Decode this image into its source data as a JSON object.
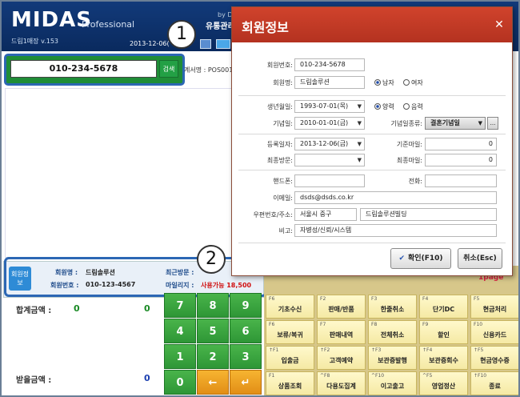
{
  "header": {
    "logo": "MIDAS",
    "logo_sub": "Professional",
    "store": "드림1매장 v.153",
    "date": "2013-12-06(",
    "by": "by Dre",
    "corp": "유통관리"
  },
  "search": {
    "phone": "010-234-5678",
    "button": "검색",
    "register_label": "계서명 : POS001"
  },
  "member": {
    "tag": "회원정보",
    "name_label": "회원명 :",
    "name_value": "드림솔루션",
    "no_label": "회원번호 :",
    "no_value": "010-123-4567",
    "visit_label": "최근방문 :",
    "visit_value": "",
    "mileage_label": "마일리지 :",
    "mileage_value": "사용가능 18,500"
  },
  "totals": {
    "total_label": "합계금액 :",
    "total_a": "0",
    "total_b": "0",
    "received_label": "받을금액 :",
    "received": "0"
  },
  "badges": {
    "one": "1",
    "two": "2"
  },
  "numpad": {
    "keys": [
      "7",
      "8",
      "9",
      "4",
      "5",
      "6",
      "1",
      "2",
      "3",
      "0",
      "←",
      "↵"
    ]
  },
  "fkeys": [
    {
      "code": "F6",
      "label": "기초수신"
    },
    {
      "code": "F2",
      "label": "판매/반품"
    },
    {
      "code": "F3",
      "label": "한줄취소"
    },
    {
      "code": "F4",
      "label": "단기DC"
    },
    {
      "code": "F5",
      "label": "현금처리"
    },
    {
      "code": "F6",
      "label": "보류/복귀"
    },
    {
      "code": "F7",
      "label": "판매내역"
    },
    {
      "code": "F8",
      "label": "전체취소"
    },
    {
      "code": "F9",
      "label": "할인"
    },
    {
      "code": "F10",
      "label": "신용카드"
    },
    {
      "code": "↑F1",
      "label": "입출금"
    },
    {
      "code": "↑F2",
      "label": "고객예약"
    },
    {
      "code": "↑F3",
      "label": "보관증발행"
    },
    {
      "code": "↑F4",
      "label": "보관증회수"
    },
    {
      "code": "↑F5",
      "label": "현금영수증"
    },
    {
      "code": "F1",
      "label": "상품조회"
    },
    {
      "code": "^F8",
      "label": "다용도집계"
    },
    {
      "code": "^F10",
      "label": "이고출고"
    },
    {
      "code": "^F5",
      "label": "영업정산"
    },
    {
      "code": "↑F10",
      "label": "종료"
    }
  ],
  "page_mark": "1page",
  "modal": {
    "title": "회원정보",
    "close": "✕",
    "member_no_label": "회원번호:",
    "member_no": "010-234-5678",
    "member_name_label": "회원명:",
    "member_name": "드림솔루션",
    "male": "남자",
    "female": "여자",
    "birth_label": "생년월일:",
    "birth": "1993-07-01(목)",
    "solar": "양력",
    "lunar": "음력",
    "anniv_label": "기념일:",
    "anniv": "2010-01-01(금)",
    "anniv_type_label": "기념일종류:",
    "anniv_type": "결혼기념일",
    "more": "...",
    "reg_label": "등록일자:",
    "reg": "2013-12-06(금)",
    "base_mileage_label": "기준마일:",
    "base_mileage": "0",
    "last_visit_label": "최종방문:",
    "last_visit": "",
    "last_mileage_label": "최종마일:",
    "last_mileage": "0",
    "mobile_label": "핸드폰:",
    "mobile": "",
    "phone_label": "전화:",
    "phone": "",
    "email_label": "이메일:",
    "email": "dsds@dsds.co.kr",
    "addr_label": "우편번호/주소:",
    "addr1": "서울시 중구",
    "addr2": "드림솔루션빌딩",
    "memo_label": "비고:",
    "memo": "자병성/신뢰/시스템",
    "ok": "확인(F10)",
    "cancel": "취소(Esc)"
  }
}
